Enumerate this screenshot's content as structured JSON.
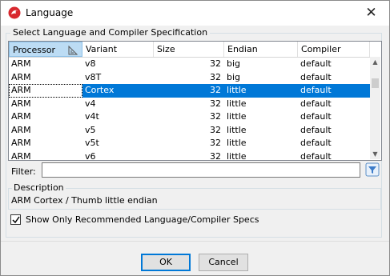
{
  "window": {
    "title": "Language"
  },
  "group_label": "Select Language and Compiler Specification",
  "table": {
    "columns": [
      "Processor",
      "Variant",
      "Size",
      "Endian",
      "Compiler"
    ],
    "rows": [
      {
        "processor": "ARM",
        "variant": "v8",
        "size": "32",
        "endian": "big",
        "compiler": "default"
      },
      {
        "processor": "ARM",
        "variant": "v8T",
        "size": "32",
        "endian": "big",
        "compiler": "default"
      },
      {
        "processor": "ARM",
        "variant": "Cortex",
        "size": "32",
        "endian": "little",
        "compiler": "default"
      },
      {
        "processor": "ARM",
        "variant": "v4",
        "size": "32",
        "endian": "little",
        "compiler": "default"
      },
      {
        "processor": "ARM",
        "variant": "v4t",
        "size": "32",
        "endian": "little",
        "compiler": "default"
      },
      {
        "processor": "ARM",
        "variant": "v5",
        "size": "32",
        "endian": "little",
        "compiler": "default"
      },
      {
        "processor": "ARM",
        "variant": "v5t",
        "size": "32",
        "endian": "little",
        "compiler": "default"
      },
      {
        "processor": "ARM",
        "variant": "v6",
        "size": "32",
        "endian": "little",
        "compiler": "default"
      }
    ],
    "selected_row": 2,
    "sorted_column": "Processor"
  },
  "filter": {
    "label": "Filter:",
    "value": ""
  },
  "description": {
    "label": "Description",
    "text": "ARM Cortex / Thumb little endian"
  },
  "recommended_checkbox": {
    "label": "Show Only Recommended Language/Compiler Specs",
    "checked": true
  },
  "buttons": {
    "ok": "OK",
    "cancel": "Cancel"
  },
  "colors": {
    "selection": "#0078d7",
    "accent": "#d8282e"
  }
}
